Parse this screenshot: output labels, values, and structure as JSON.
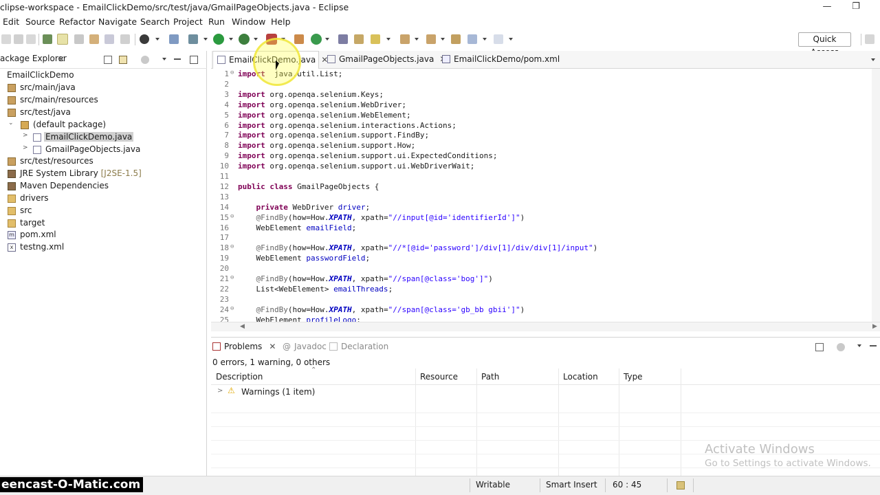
{
  "window": {
    "title": "clipse-workspace - EmailClickDemo/src/test/java/GmailPageObjects.java - Eclipse",
    "minimize_glyph": "—",
    "restore_glyph": "❐"
  },
  "menu": [
    "Edit",
    "Source",
    "Refactor",
    "Navigate",
    "Search",
    "Project",
    "Run",
    "Window",
    "Help"
  ],
  "toolbar": {
    "quick_access": "Quick Access"
  },
  "package_explorer": {
    "tab_label": "ackage Explorer",
    "tree": [
      {
        "label": "EmailClickDemo",
        "icon": "project-icon",
        "twisty": "⌄"
      },
      {
        "label": "src/main/java",
        "icon": "source-folder-icon",
        "twisty": ""
      },
      {
        "label": "src/main/resources",
        "icon": "source-folder-icon",
        "twisty": ""
      },
      {
        "label": "src/test/java",
        "icon": "source-folder-icon",
        "twisty": ""
      },
      {
        "label": "(default package)",
        "icon": "package-icon",
        "twisty": "⌄"
      },
      {
        "label": "EmailClickDemo.java",
        "icon": "java-file-icon",
        "twisty": ">",
        "selected": true
      },
      {
        "label": "GmailPageObjects.java",
        "icon": "java-file-icon",
        "twisty": ">"
      },
      {
        "label": "src/test/resources",
        "icon": "source-folder-icon",
        "twisty": ""
      },
      {
        "label": "JRE System Library",
        "suffix": "[J2SE-1.5]",
        "icon": "library-icon",
        "twisty": ""
      },
      {
        "label": "Maven Dependencies",
        "icon": "library-icon",
        "twisty": ""
      },
      {
        "label": "drivers",
        "icon": "folder-icon",
        "twisty": ""
      },
      {
        "label": "src",
        "icon": "folder-icon",
        "twisty": ""
      },
      {
        "label": "target",
        "icon": "folder-icon",
        "twisty": ""
      },
      {
        "label": "pom.xml",
        "icon": "maven-file-icon",
        "twisty": ""
      },
      {
        "label": "testng.xml",
        "icon": "xml-file-icon",
        "twisty": ""
      }
    ]
  },
  "editor": {
    "tabs": [
      {
        "label": "EmailClickDemo.java",
        "active": true
      },
      {
        "label": "GmailPageObjects.java",
        "active": false
      },
      {
        "label": "EmailClickDemo/pom.xml",
        "active": false
      }
    ],
    "lines": [
      {
        "n": "1",
        "fold": "⊖",
        "code": [
          [
            "kw",
            "import"
          ],
          [
            "",
            "  java.util.List;"
          ]
        ]
      },
      {
        "n": "2",
        "code": []
      },
      {
        "n": "3",
        "code": [
          [
            "kw",
            "import"
          ],
          [
            "",
            " org.openqa.selenium.Keys;"
          ]
        ]
      },
      {
        "n": "4",
        "code": [
          [
            "kw",
            "import"
          ],
          [
            "",
            " org.openqa.selenium.WebDriver;"
          ]
        ]
      },
      {
        "n": "5",
        "code": [
          [
            "kw",
            "import"
          ],
          [
            "",
            " org.openqa.selenium.WebElement;"
          ]
        ]
      },
      {
        "n": "6",
        "code": [
          [
            "kw",
            "import"
          ],
          [
            "",
            " org.openqa.selenium.interactions.Actions;"
          ]
        ]
      },
      {
        "n": "7",
        "code": [
          [
            "kw",
            "import"
          ],
          [
            "",
            " org.openqa.selenium.support.FindBy;"
          ]
        ]
      },
      {
        "n": "8",
        "code": [
          [
            "kw",
            "import"
          ],
          [
            "",
            " org.openqa.selenium.support.How;"
          ]
        ]
      },
      {
        "n": "9",
        "code": [
          [
            "kw",
            "import"
          ],
          [
            "",
            " org.openqa.selenium.support.ui.ExpectedConditions;"
          ]
        ]
      },
      {
        "n": "10",
        "code": [
          [
            "kw",
            "import"
          ],
          [
            "",
            " org.openqa.selenium.support.ui.WebDriverWait;"
          ]
        ]
      },
      {
        "n": "11",
        "code": []
      },
      {
        "n": "12",
        "code": [
          [
            "kw",
            "public"
          ],
          [
            "",
            " "
          ],
          [
            "kw",
            "class"
          ],
          [
            "",
            " GmailPageObjects {"
          ]
        ]
      },
      {
        "n": "13",
        "code": []
      },
      {
        "n": "14",
        "code": [
          [
            "",
            "    "
          ],
          [
            "kw",
            "private"
          ],
          [
            "",
            " WebDriver "
          ],
          [
            "fld",
            "driver"
          ],
          [
            "",
            ";"
          ]
        ]
      },
      {
        "n": "15",
        "fold": "⊖",
        "code": [
          [
            "",
            "    "
          ],
          [
            "ann",
            "@FindBy"
          ],
          [
            "",
            "(how=How."
          ],
          [
            "it",
            "XPATH"
          ],
          [
            "",
            ", xpath="
          ],
          [
            "str",
            "\"//input[@id='identifierId']\""
          ],
          [
            "",
            ")"
          ]
        ]
      },
      {
        "n": "16",
        "code": [
          [
            "",
            "    WebElement "
          ],
          [
            "fld",
            "emailField"
          ],
          [
            "",
            ";"
          ]
        ]
      },
      {
        "n": "17",
        "code": []
      },
      {
        "n": "18",
        "fold": "⊖",
        "code": [
          [
            "",
            "    "
          ],
          [
            "ann",
            "@FindBy"
          ],
          [
            "",
            "(how=How."
          ],
          [
            "it",
            "XPATH"
          ],
          [
            "",
            ", xpath="
          ],
          [
            "str",
            "\"//*[@id='password']/div[1]/div/div[1]/input\""
          ],
          [
            "",
            ")"
          ]
        ]
      },
      {
        "n": "19",
        "code": [
          [
            "",
            "    WebElement "
          ],
          [
            "fld",
            "passwordField"
          ],
          [
            "",
            ";"
          ]
        ]
      },
      {
        "n": "20",
        "code": []
      },
      {
        "n": "21",
        "fold": "⊖",
        "code": [
          [
            "",
            "    "
          ],
          [
            "ann",
            "@FindBy"
          ],
          [
            "",
            "(how=How."
          ],
          [
            "it",
            "XPATH"
          ],
          [
            "",
            ", xpath="
          ],
          [
            "str",
            "\"//span[@class='bog']\""
          ],
          [
            "",
            ")"
          ]
        ]
      },
      {
        "n": "22",
        "code": [
          [
            "",
            "    List<WebElement> "
          ],
          [
            "fld",
            "emailThreads"
          ],
          [
            "",
            ";"
          ]
        ]
      },
      {
        "n": "23",
        "code": []
      },
      {
        "n": "24",
        "fold": "⊖",
        "code": [
          [
            "",
            "    "
          ],
          [
            "ann",
            "@FindBy"
          ],
          [
            "",
            "(how=How."
          ],
          [
            "it",
            "XPATH"
          ],
          [
            "",
            ", xpath="
          ],
          [
            "str",
            "\"//span[@class='gb_bb gbii']\""
          ],
          [
            "",
            ")"
          ]
        ]
      },
      {
        "n": "25",
        "code": [
          [
            "",
            "    WebElement "
          ],
          [
            "fld",
            "profileLogo"
          ],
          [
            "",
            ";"
          ]
        ]
      }
    ]
  },
  "problems": {
    "tabs": [
      "Problems",
      "Javadoc",
      "Declaration"
    ],
    "summary": "0 errors, 1 warning, 0 others",
    "columns": [
      "Description",
      "Resource",
      "Path",
      "Location",
      "Type"
    ],
    "rows": [
      {
        "description": "Warnings (1 item)",
        "twisty": ">"
      }
    ]
  },
  "statusbar": {
    "writable": "Writable",
    "insert_mode": "Smart Insert",
    "position": "60 : 45"
  },
  "overlay": {
    "recorder": "eencast-O-Matic.com",
    "activate_title": "Activate Windows",
    "activate_sub": "Go to Settings to activate Windows."
  }
}
